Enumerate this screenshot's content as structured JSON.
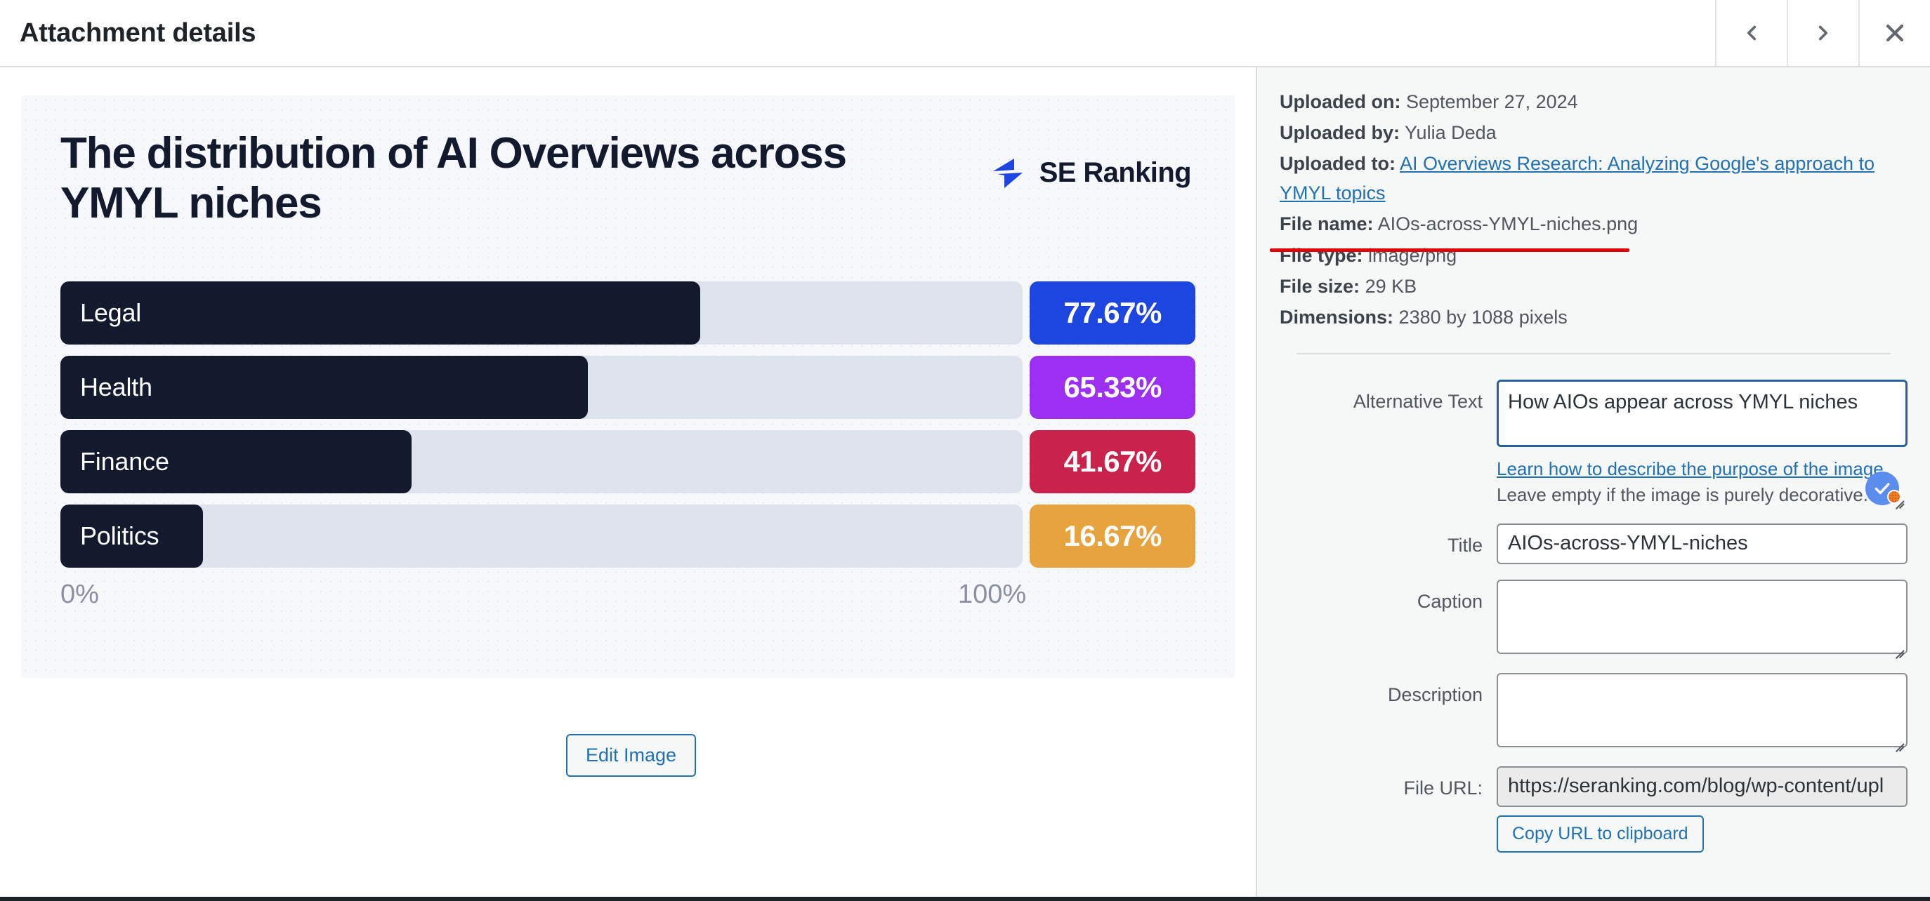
{
  "header": {
    "title": "Attachment details",
    "prev_label": "Previous",
    "next_label": "Next",
    "close_label": "Close"
  },
  "preview": {
    "edit_image_label": "Edit Image",
    "brand_name": "SE Ranking"
  },
  "chart_data": {
    "type": "bar",
    "orientation": "horizontal",
    "title": "The distribution of AI Overviews across YMYL niches",
    "xlabel": "",
    "ylabel": "",
    "xlim": [
      0,
      100
    ],
    "axis_min_label": "0%",
    "axis_max_label": "100%",
    "grid": false,
    "legend": "none",
    "categories": [
      "Legal",
      "Health",
      "Finance",
      "Politics"
    ],
    "values": [
      77.67,
      65.33,
      41.67,
      16.67
    ],
    "value_labels": [
      "77.67%",
      "65.33%",
      "41.67%",
      "16.67%"
    ],
    "bar_fill_ratio": [
      0.665,
      0.548,
      0.365,
      0.148
    ],
    "colors": [
      "#1d46e0",
      "#9c2ff2",
      "#c9224b",
      "#e7a33e"
    ],
    "bar_color": "#131a2e",
    "track_color": "#dfe3ee"
  },
  "attachment_meta": {
    "uploaded_on_label": "Uploaded on:",
    "uploaded_on_value": "September 27, 2024",
    "uploaded_by_label": "Uploaded by:",
    "uploaded_by_value": "Yulia Deda",
    "uploaded_to_label": "Uploaded to:",
    "uploaded_to_value": "AI Overviews Research: Analyzing Google's approach to YMYL topics",
    "file_name_label": "File name:",
    "file_name_value": "AIOs-across-YMYL-niches.png",
    "file_type_label": "File type:",
    "file_type_value": "image/png",
    "file_size_label": "File size:",
    "file_size_value": "29 KB",
    "dimensions_label": "Dimensions:",
    "dimensions_value": "2380 by 1088 pixels",
    "annotation_color": "#e00000"
  },
  "form": {
    "alt_text": {
      "label": "Alternative Text",
      "value": "How AIOs appear across YMYL niches",
      "help_link": "Learn how to describe the purpose of the image",
      "help_link_suffix": ".",
      "help_note": "Leave empty if the image is purely decorative."
    },
    "title": {
      "label": "Title",
      "value": "AIOs-across-YMYL-niches"
    },
    "caption": {
      "label": "Caption",
      "value": ""
    },
    "description": {
      "label": "Description",
      "value": ""
    },
    "file_url": {
      "label": "File URL:",
      "value": "https://seranking.com/blog/wp-content/upl"
    },
    "copy_url_label": "Copy URL to clipboard"
  }
}
